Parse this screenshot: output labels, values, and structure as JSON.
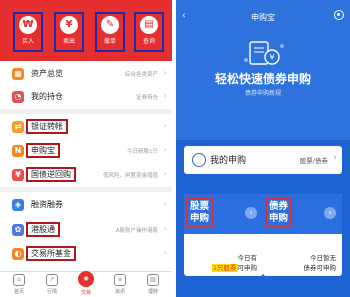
{
  "left": {
    "status_time": "",
    "quick_actions": [
      {
        "icon": "buy-icon",
        "glyph": "₩",
        "label": "买入"
      },
      {
        "icon": "sell-icon",
        "glyph": "¥",
        "label": "卖出"
      },
      {
        "icon": "cancel-order-icon",
        "glyph": "✎",
        "label": "撤单"
      },
      {
        "icon": "query-icon",
        "glyph": "▤",
        "label": "查询"
      }
    ],
    "menu": [
      {
        "label": "资产总览",
        "right": "综合各类资产",
        "icon_color": "#f08a24"
      },
      {
        "label": "我的持仓",
        "right": "证券持仓",
        "icon_color": "#e55353"
      },
      {
        "label": "银证转帐",
        "right": "",
        "icon_color": "#f3a12c"
      },
      {
        "label": "申购宝",
        "right": "今日新股1只",
        "icon_color": "#f08a24"
      },
      {
        "label": "国债逆回购",
        "right": "低风险，闲置资金增值",
        "icon_color": "#e94e4e"
      },
      {
        "label": "融资融券",
        "right": "",
        "icon_color": "#3b7de0"
      },
      {
        "label": "港股通",
        "right": "A股账户操作港股",
        "icon_color": "#4f79d9"
      },
      {
        "label": "交易所基金",
        "right": "",
        "icon_color": "#f08a24"
      }
    ],
    "tabbar": [
      {
        "label": "首页",
        "icon": "home-icon"
      },
      {
        "label": "行情",
        "icon": "market-icon"
      },
      {
        "label": "交易",
        "icon": "trade-icon"
      },
      {
        "label": "资讯",
        "icon": "news-icon"
      },
      {
        "label": "理财",
        "icon": "wealth-icon"
      }
    ]
  },
  "right": {
    "title": "申购宝",
    "headline": "轻松快速债券申购",
    "subheadline": "债券申购新规",
    "my_subscription": {
      "label": "我的申购",
      "right": "股票/债券"
    },
    "tiles": [
      {
        "title_line1": "股票",
        "title_line2": "申购",
        "arrow": "›",
        "line1": "今日有",
        "line2_highlight": "1只股票",
        "line2_rest": "可申购"
      },
      {
        "title_line1": "债券",
        "title_line2": "申购",
        "arrow": "›",
        "line1": "今日暂无",
        "line2_highlight": "",
        "line2_rest": "债券可申购"
      }
    ]
  },
  "colors": {
    "left_accent": "#e52e2e",
    "right_bg": "#1d63d4",
    "annotation_box": "#d3343a",
    "annotation_box_blue": "#1d2aa8"
  }
}
